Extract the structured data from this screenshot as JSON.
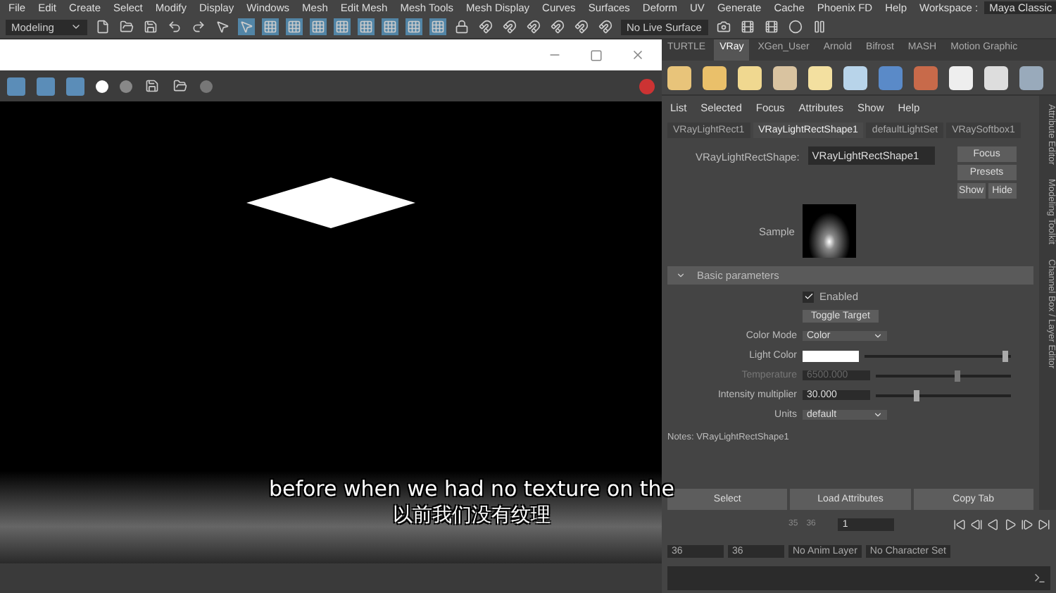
{
  "menu_bar": {
    "items": [
      "File",
      "Edit",
      "Create",
      "Select",
      "Modify",
      "Display",
      "Windows",
      "Mesh",
      "Edit Mesh",
      "Mesh Tools",
      "Mesh Display",
      "Curves",
      "Surfaces",
      "Deform",
      "UV",
      "Generate",
      "Cache",
      "Phoenix FD",
      "Help"
    ],
    "workspace_label": "Workspace :",
    "workspace": "Maya Classic"
  },
  "toolbar": {
    "mode": "Modeling",
    "live_surface": "No Live Surface"
  },
  "subtitles": [
    "before when we had no texture on the",
    "以前我们没有纹理"
  ],
  "shelf": {
    "tabs": [
      {
        "label": "TURTLE",
        "selected": false
      },
      {
        "label": "VRay",
        "selected": true
      },
      {
        "label": "XGen_User",
        "selected": false
      },
      {
        "label": "Arnold",
        "selected": false
      },
      {
        "label": "Bifrost",
        "selected": false
      },
      {
        "label": "MASH",
        "selected": false
      },
      {
        "label": "Motion Graphic",
        "selected": false
      }
    ]
  },
  "attribute_editor": {
    "menu": [
      "List",
      "Selected",
      "Focus",
      "Attributes",
      "Show",
      "Help"
    ],
    "tabs": [
      {
        "label": "VRayLightRect1",
        "selected": false
      },
      {
        "label": "VRayLightRectShape1",
        "selected": true
      },
      {
        "label": "defaultLightSet",
        "selected": false
      },
      {
        "label": "VRaySoftbox1",
        "selected": false
      }
    ],
    "node_label": "VRayLightRectShape:",
    "node_name": "VRayLightRectShape1",
    "side_buttons": [
      "Focus",
      "Presets",
      "Show",
      "Hide"
    ],
    "sample_label": "Sample",
    "section": {
      "title": "Basic parameters",
      "expanded": true
    },
    "rows": [
      {
        "kind": "checkbox",
        "label": "Enabled",
        "checked": true
      },
      {
        "kind": "button",
        "label": "Toggle Target"
      },
      {
        "kind": "dropdown",
        "label": "Color Mode",
        "value": "Color"
      },
      {
        "kind": "color",
        "label": "Light Color",
        "level": 0.96
      },
      {
        "kind": "slider",
        "label": "Temperature",
        "value": "6500.000",
        "level": 0.6,
        "disabled": true
      },
      {
        "kind": "slider",
        "label": "Intensity multiplier",
        "value": "30.000",
        "level": 0.3,
        "disabled": false
      },
      {
        "kind": "dropdown",
        "label": "Units",
        "value": "default"
      }
    ],
    "notes": "Notes:  VRayLightRectShape1",
    "buttons": [
      "Select",
      "Load Attributes",
      "Copy Tab"
    ],
    "side_tabs": [
      "Attribute Editor",
      "Modeling Toolkit",
      "Channel Box / Layer Editor"
    ]
  },
  "timeline": {
    "ticks": [
      "35",
      "36"
    ],
    "current_frame": "1"
  },
  "range": {
    "start": "36",
    "end": "36",
    "anim_layer": "No Anim Layer",
    "character_set": "No Character Set"
  }
}
